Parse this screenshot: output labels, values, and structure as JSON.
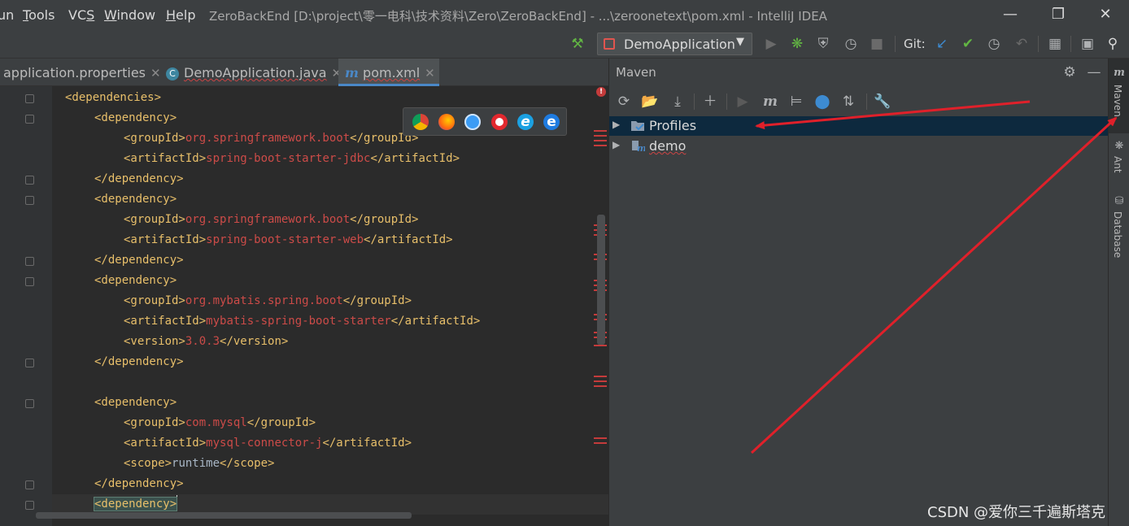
{
  "menu": {
    "items": [
      {
        "pre": "",
        "ul": "",
        "post": "un"
      },
      {
        "pre": "",
        "ul": "T",
        "post": "ools"
      },
      {
        "pre": "VC",
        "ul": "S",
        "post": ""
      },
      {
        "pre": "",
        "ul": "W",
        "post": "indow"
      },
      {
        "pre": "",
        "ul": "H",
        "post": "elp"
      }
    ]
  },
  "window": {
    "title": "ZeroBackEnd [D:\\project\\零一电科\\技术资料\\Zero\\ZeroBackEnd] - ...\\zeroonetext\\pom.xml - IntelliJ IDEA"
  },
  "toolbar": {
    "run_config": "DemoApplication",
    "git_label": "Git:"
  },
  "editor_tabs": [
    {
      "label": "application.properties",
      "active": false
    },
    {
      "label": "DemoApplication.java",
      "active": false
    },
    {
      "label": "pom.xml",
      "active": true
    }
  ],
  "code": {
    "lines": [
      {
        "indent": 0,
        "parts": [
          {
            "c": "tag",
            "t": "<dependencies>"
          }
        ]
      },
      {
        "indent": 1,
        "parts": [
          {
            "c": "tag",
            "t": "<dependency>"
          }
        ]
      },
      {
        "indent": 2,
        "parts": [
          {
            "c": "tag",
            "t": "<groupId>"
          },
          {
            "c": "val",
            "t": "org.springframework.boot"
          },
          {
            "c": "tag",
            "t": "</groupId>"
          }
        ]
      },
      {
        "indent": 2,
        "parts": [
          {
            "c": "tag",
            "t": "<artifactId>"
          },
          {
            "c": "val",
            "t": "spring-boot-starter-jdbc"
          },
          {
            "c": "tag",
            "t": "</artifactId>"
          }
        ]
      },
      {
        "indent": 1,
        "parts": [
          {
            "c": "tag",
            "t": "</dependency>"
          }
        ]
      },
      {
        "indent": 1,
        "parts": [
          {
            "c": "tag",
            "t": "<dependency>"
          }
        ]
      },
      {
        "indent": 2,
        "parts": [
          {
            "c": "tag",
            "t": "<groupId>"
          },
          {
            "c": "val",
            "t": "org.springframework.boot"
          },
          {
            "c": "tag",
            "t": "</groupId>"
          }
        ]
      },
      {
        "indent": 2,
        "parts": [
          {
            "c": "tag",
            "t": "<artifactId>"
          },
          {
            "c": "val",
            "t": "spring-boot-starter-web"
          },
          {
            "c": "tag",
            "t": "</artifactId>"
          }
        ]
      },
      {
        "indent": 1,
        "parts": [
          {
            "c": "tag",
            "t": "</dependency>"
          }
        ]
      },
      {
        "indent": 1,
        "parts": [
          {
            "c": "tag",
            "t": "<dependency>"
          }
        ]
      },
      {
        "indent": 2,
        "parts": [
          {
            "c": "tag",
            "t": "<groupId>"
          },
          {
            "c": "val",
            "t": "org.mybatis.spring.boot"
          },
          {
            "c": "tag",
            "t": "</groupId>"
          }
        ]
      },
      {
        "indent": 2,
        "parts": [
          {
            "c": "tag",
            "t": "<artifactId>"
          },
          {
            "c": "val",
            "t": "mybatis-spring-boot-starter"
          },
          {
            "c": "tag",
            "t": "</artifactId>"
          }
        ]
      },
      {
        "indent": 2,
        "parts": [
          {
            "c": "tag",
            "t": "<version>"
          },
          {
            "c": "val",
            "t": "3.0.3"
          },
          {
            "c": "tag",
            "t": "</version>"
          }
        ]
      },
      {
        "indent": 1,
        "parts": [
          {
            "c": "tag",
            "t": "</dependency>"
          }
        ]
      },
      {
        "indent": 0,
        "parts": []
      },
      {
        "indent": 1,
        "parts": [
          {
            "c": "tag",
            "t": "<dependency>"
          }
        ]
      },
      {
        "indent": 2,
        "parts": [
          {
            "c": "tag",
            "t": "<groupId>"
          },
          {
            "c": "val",
            "t": "com.mysql"
          },
          {
            "c": "tag",
            "t": "</groupId>"
          }
        ]
      },
      {
        "indent": 2,
        "parts": [
          {
            "c": "tag",
            "t": "<artifactId>"
          },
          {
            "c": "val",
            "t": "mysql-connector-j"
          },
          {
            "c": "tag",
            "t": "</artifactId>"
          }
        ]
      },
      {
        "indent": 2,
        "parts": [
          {
            "c": "tag",
            "t": "<scope>"
          },
          {
            "c": "txt",
            "t": "runtime"
          },
          {
            "c": "tag",
            "t": "</scope>"
          }
        ]
      },
      {
        "indent": 1,
        "parts": [
          {
            "c": "tag",
            "t": "</dependency>"
          }
        ]
      },
      {
        "indent": 1,
        "parts": [
          {
            "c": "hl",
            "t": "<dependency>"
          }
        ]
      }
    ]
  },
  "maven": {
    "title": "Maven",
    "tree": [
      {
        "label": "Profiles",
        "selected": true,
        "icon": "profiles-icon"
      },
      {
        "label": "demo",
        "selected": false,
        "icon": "maven-module-icon"
      }
    ]
  },
  "right_strip": {
    "items": [
      {
        "label": "Maven",
        "icon": "m",
        "active": true
      },
      {
        "label": "Ant",
        "icon": "ant",
        "active": false
      },
      {
        "label": "Database",
        "icon": "db",
        "active": false
      }
    ]
  },
  "watermark": "CSDN @爱你三千遍斯塔克",
  "colors": {
    "editor_bg": "#2b2b2b",
    "panel_bg": "#3c3f41",
    "tag": "#e8bf6a",
    "value": "#cc4b48",
    "selection": "#0d293e",
    "annotation_arrow": "#e0202a"
  }
}
